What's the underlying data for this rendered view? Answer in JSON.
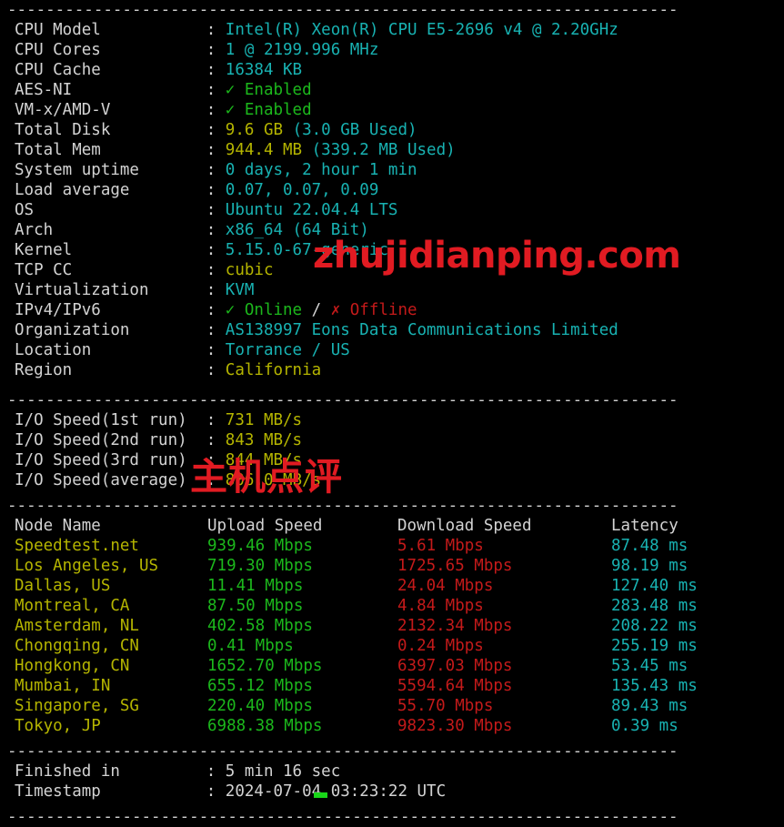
{
  "terminal": {
    "separator": "----------------------------------------------------------------------",
    "colors": {
      "background": "#000000",
      "label": "#d3d3d3",
      "cyan": "#18b2b2",
      "green": "#1cb81c",
      "yellow": "#b5b500",
      "red": "#c41a1a",
      "watermark": "#e11b22",
      "cursor": "#19d619"
    }
  },
  "watermarks": {
    "domain": "zhujidianping.com",
    "chinese": "主机点评"
  },
  "system_info": {
    "rows": [
      {
        "label": "CPU Model",
        "colon": ":",
        "value": "Intel(R) Xeon(R) CPU E5-2696 v4 @ 2.20GHz",
        "color": "cyan"
      },
      {
        "label": "CPU Cores",
        "colon": ":",
        "value": "1 @ 2199.996 MHz",
        "color": "cyan"
      },
      {
        "label": "CPU Cache",
        "colon": ":",
        "value": "16384 KB",
        "color": "cyan"
      },
      {
        "label": "AES-NI",
        "colon": ":",
        "value": "✓ Enabled",
        "color": "green"
      },
      {
        "label": "VM-x/AMD-V",
        "colon": ":",
        "value": "✓ Enabled",
        "color": "green"
      },
      {
        "label": "Total Disk",
        "colon": ":",
        "value_main": "9.6 GB",
        "value_paren": "(3.0 GB Used)",
        "color": "yellow",
        "paren_color": "cyan"
      },
      {
        "label": "Total Mem",
        "colon": ":",
        "value_main": "944.4 MB",
        "value_paren": "(339.2 MB Used)",
        "color": "yellow",
        "paren_color": "cyan"
      },
      {
        "label": "System uptime",
        "colon": ":",
        "value": "0 days, 2 hour 1 min",
        "color": "cyan"
      },
      {
        "label": "Load average",
        "colon": ":",
        "value": "0.07, 0.07, 0.09",
        "color": "cyan"
      },
      {
        "label": "OS",
        "colon": ":",
        "value": "Ubuntu 22.04.4 LTS",
        "color": "cyan"
      },
      {
        "label": "Arch",
        "colon": ":",
        "value": "x86_64 (64 Bit)",
        "color": "cyan"
      },
      {
        "label": "Kernel",
        "colon": ":",
        "value": "5.15.0-67-generic",
        "color": "cyan"
      },
      {
        "label": "TCP CC",
        "colon": ":",
        "value": "cubic",
        "color": "yellow"
      },
      {
        "label": "Virtualization",
        "colon": ":",
        "value": "KVM",
        "color": "cyan"
      },
      {
        "label": "IPv4/IPv6",
        "colon": ":",
        "ipv4": "✓ Online",
        "sep": " / ",
        "ipv6": "✗ Offline"
      },
      {
        "label": "Organization",
        "colon": ":",
        "value": "AS138997 Eons Data Communications Limited",
        "color": "cyan"
      },
      {
        "label": "Location",
        "colon": ":",
        "value": "Torrance / US",
        "color": "cyan"
      },
      {
        "label": "Region",
        "colon": ":",
        "value": "California",
        "color": "yellow"
      }
    ]
  },
  "io_speed": {
    "rows": [
      {
        "label": "I/O Speed(1st run)",
        "colon": ":",
        "value": "731 MB/s",
        "color": "yellow"
      },
      {
        "label": "I/O Speed(2nd run)",
        "colon": ":",
        "value": "843 MB/s",
        "color": "yellow"
      },
      {
        "label": "I/O Speed(3rd run)",
        "colon": ":",
        "value": "844 MB/s",
        "color": "yellow"
      },
      {
        "label": "I/O Speed(average)",
        "colon": ":",
        "value": "806.0 MB/s",
        "color": "yellow"
      }
    ]
  },
  "speedtest": {
    "headers": {
      "node": "Node Name",
      "upload": "Upload Speed",
      "download": "Download Speed",
      "latency": "Latency"
    },
    "rows": [
      {
        "node": "Speedtest.net",
        "upload": "939.46 Mbps",
        "download": "5.61 Mbps",
        "latency": "87.48 ms"
      },
      {
        "node": "Los Angeles, US",
        "upload": "719.30 Mbps",
        "download": "1725.65 Mbps",
        "latency": "98.19 ms"
      },
      {
        "node": "Dallas, US",
        "upload": "11.41 Mbps",
        "download": "24.04 Mbps",
        "latency": "127.40 ms"
      },
      {
        "node": "Montreal, CA",
        "upload": "87.50 Mbps",
        "download": "4.84 Mbps",
        "latency": "283.48 ms"
      },
      {
        "node": "Amsterdam, NL",
        "upload": "402.58 Mbps",
        "download": "2132.34 Mbps",
        "latency": "208.22 ms"
      },
      {
        "node": "Chongqing, CN",
        "upload": "0.41 Mbps",
        "download": "0.24 Mbps",
        "latency": "255.19 ms"
      },
      {
        "node": "Hongkong, CN",
        "upload": "1652.70 Mbps",
        "download": "6397.03 Mbps",
        "latency": "53.45 ms"
      },
      {
        "node": "Mumbai, IN",
        "upload": "655.12 Mbps",
        "download": "5594.64 Mbps",
        "latency": "135.43 ms"
      },
      {
        "node": "Singapore, SG",
        "upload": "220.40 Mbps",
        "download": "55.70 Mbps",
        "latency": "89.43 ms"
      },
      {
        "node": "Tokyo, JP",
        "upload": "6988.38 Mbps",
        "download": "9823.30 Mbps",
        "latency": "0.39 ms"
      }
    ]
  },
  "footer": {
    "rows": [
      {
        "label": "Finished in",
        "colon": ":",
        "value": "5 min 16 sec"
      },
      {
        "label": "Timestamp",
        "colon": ":",
        "value": "2024-07-04 03:23:22 UTC"
      }
    ]
  }
}
